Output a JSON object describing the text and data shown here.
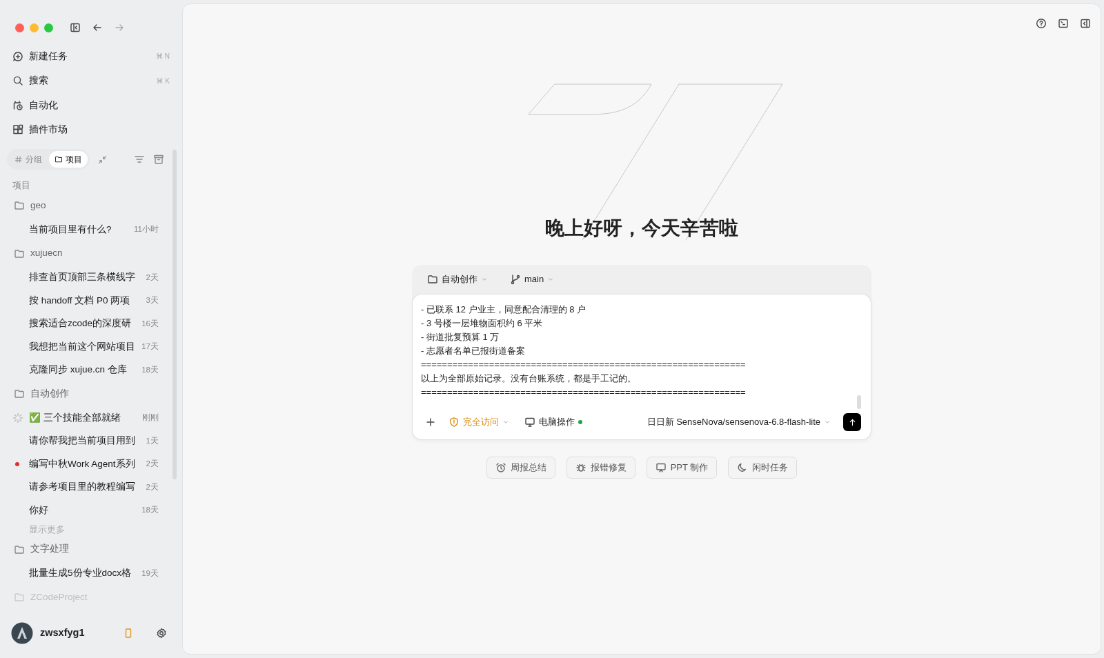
{
  "sidebar": {
    "nav": [
      {
        "label": "新建任务",
        "shortcut": "⌘ N",
        "kind": "new"
      },
      {
        "label": "搜索",
        "shortcut": "⌘ K",
        "kind": "search"
      },
      {
        "label": "自动化",
        "kind": "auto"
      },
      {
        "label": "插件市场",
        "kind": "plugins"
      }
    ],
    "tabs": [
      {
        "label": "分组",
        "selected": false,
        "kind": "hash"
      },
      {
        "label": "项目",
        "selected": true,
        "kind": "folder"
      }
    ],
    "section_label": "项目",
    "projects": [
      {
        "name": "geo",
        "tasks": [
          {
            "title": "当前项目里有什么?",
            "time": "11小时",
            "running": false,
            "unread": false
          }
        ]
      },
      {
        "name": "xujuecn",
        "tasks": [
          {
            "title": "排查首页顶部三条横线字",
            "time": "2天",
            "running": false,
            "unread": false
          },
          {
            "title": "按 handoff 文档 P0 两项",
            "time": "3天",
            "running": false,
            "unread": false
          },
          {
            "title": "搜索适合zcode的深度研",
            "time": "16天",
            "running": false,
            "unread": false
          },
          {
            "title": "我想把当前这个网站项目",
            "time": "17天",
            "running": false,
            "unread": false
          },
          {
            "title": "克隆同步 xujue.cn 仓库",
            "time": "18天",
            "running": false,
            "unread": false
          }
        ]
      },
      {
        "name": "自动创作",
        "tasks": [
          {
            "title": "✅ 三个技能全部就绪",
            "time": "刚刚",
            "running": true,
            "unread": false
          },
          {
            "title": "请你帮我把当前项目用到",
            "time": "1天",
            "running": false,
            "unread": false
          },
          {
            "title": "编写中秋Work Agent系列",
            "time": "2天",
            "running": false,
            "unread": true
          },
          {
            "title": "请参考项目里的教程编写",
            "time": "2天",
            "running": false,
            "unread": false
          },
          {
            "title": "你好",
            "time": "18天",
            "running": false,
            "unread": false
          }
        ],
        "show_more": "显示更多"
      },
      {
        "name": "文字处理",
        "tasks": [
          {
            "title": "批量生成5份专业docx格",
            "time": "19天",
            "running": false,
            "unread": false
          }
        ]
      },
      {
        "name": "ZCodeProject",
        "faded": true
      }
    ],
    "user": {
      "name": "zwsxfyg1"
    }
  },
  "main": {
    "greeting": "晚上好呀，今天辛苦啦",
    "composer": {
      "folder": "自动创作",
      "branch": "main",
      "text": "- 已联系 12 户业主，同意配合清理的 8 户\n- 3 号楼一层堆物面积约 6 平米\n- 街道批复预算 1 万\n- 志愿者名单已报街道备案\n==============================================================\n以上为全部原始记录。没有台账系统，都是手工记的。\n==============================================================",
      "access": "完全访问",
      "computer": "电脑操作",
      "computer_on": true,
      "model": "日日新 SenseNova/sensenova-6.8-flash-lite"
    },
    "quick_actions": [
      {
        "label": "周报总结",
        "kind": "alarm"
      },
      {
        "label": "报错修复",
        "kind": "bug"
      },
      {
        "label": "PPT 制作",
        "kind": "screen"
      },
      {
        "label": "闲时任务",
        "kind": "moon"
      }
    ]
  }
}
